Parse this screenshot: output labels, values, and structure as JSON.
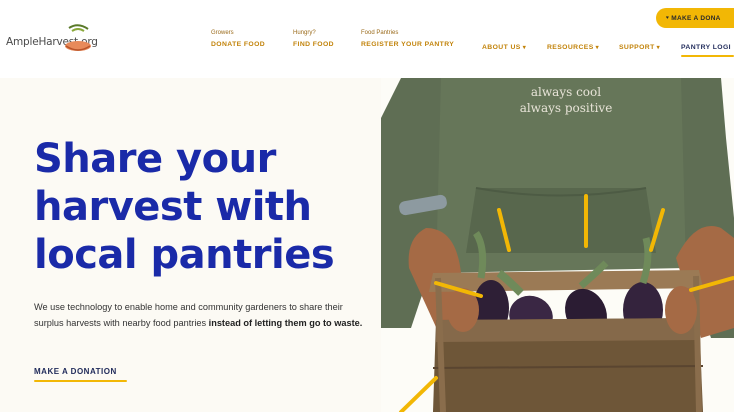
{
  "header": {
    "logo_text": "AmpleHarvest.org",
    "nav": [
      {
        "sub": "Growers",
        "label": "DONATE FOOD"
      },
      {
        "sub": "Hungry?",
        "label": "FIND FOOD"
      },
      {
        "sub": "Food Pantries",
        "label": "REGISTER YOUR PANTRY"
      }
    ],
    "menus": {
      "about": "ABOUT US",
      "resources": "RESOURCES",
      "support": "SUPPORT",
      "login": "PANTRY LOGI"
    },
    "cta": "MAKE A DONA"
  },
  "hero": {
    "title_lines": [
      "Share your",
      "harvest with",
      "local pantries"
    ],
    "body": "We use technology to enable home and community gardeners to share their surplus harvests with nearby food pantries ",
    "body_bold": "instead of letting them go to waste.",
    "cta": "MAKE A DONATION",
    "shirt_text": [
      "always cool",
      "always positive"
    ]
  },
  "colors": {
    "brand_blue": "#1a2aa8",
    "accent_yellow": "#f2b705",
    "nav_gold": "#c2830a",
    "shirt_green": "#5e6e54"
  }
}
